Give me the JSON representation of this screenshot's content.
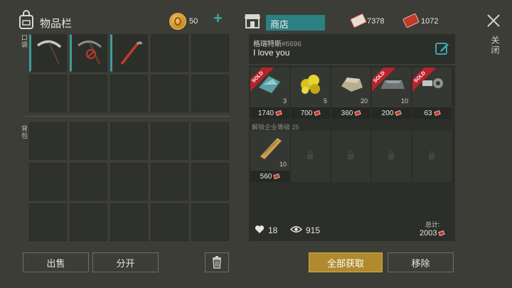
{
  "inventory": {
    "title": "物品栏",
    "coins": "50",
    "pocket_label": "口袋",
    "bag_label": "背包",
    "pocket_slots": [
      {
        "item": "pickaxe-icon"
      },
      {
        "item": "broken-pickaxe-icon"
      },
      {
        "item": "crowbar-icon"
      },
      {
        "item": ""
      },
      {
        "item": ""
      },
      {
        "item": ""
      },
      {
        "item": ""
      },
      {
        "item": ""
      },
      {
        "item": ""
      },
      {
        "item": ""
      }
    ],
    "bag_slot_count": 15,
    "sell_label": "出售",
    "split_label": "分开"
  },
  "shop": {
    "title": "商店",
    "currency_a": "7378",
    "currency_b": "1072",
    "close_label": "关闭",
    "seller_name": "格瑞特斯",
    "seller_id": "#6696",
    "message": "I love you",
    "sold_label": "SOLD",
    "items": [
      {
        "name": "glass-shard-icon",
        "qty": "3",
        "price": "1740",
        "sold": true,
        "color": "#5fb3b8"
      },
      {
        "name": "sulfur-icon",
        "qty": "5",
        "price": "700",
        "sold": false,
        "color": "#d8c21e"
      },
      {
        "name": "stone-icon",
        "qty": "20",
        "price": "360",
        "sold": false,
        "color": "#b9ad91"
      },
      {
        "name": "iron-ingot-icon",
        "qty": "10",
        "price": "200",
        "sold": true,
        "color": "#9aa0a2"
      },
      {
        "name": "bolts-icon",
        "qty": "",
        "price": "63",
        "sold": true,
        "color": "#bfc4c6"
      }
    ],
    "unlock_label": "解锁企业等级 25",
    "row2": [
      {
        "name": "wood-plank-icon",
        "qty": "10",
        "price": "560",
        "locked": false,
        "color": "#c7a050"
      },
      {
        "locked": true
      },
      {
        "locked": true
      },
      {
        "locked": true
      },
      {
        "locked": true
      }
    ],
    "likes": "18",
    "views": "915",
    "total_label": "总计:",
    "total": "2003",
    "get_all_label": "全部获取",
    "remove_label": "移除"
  }
}
